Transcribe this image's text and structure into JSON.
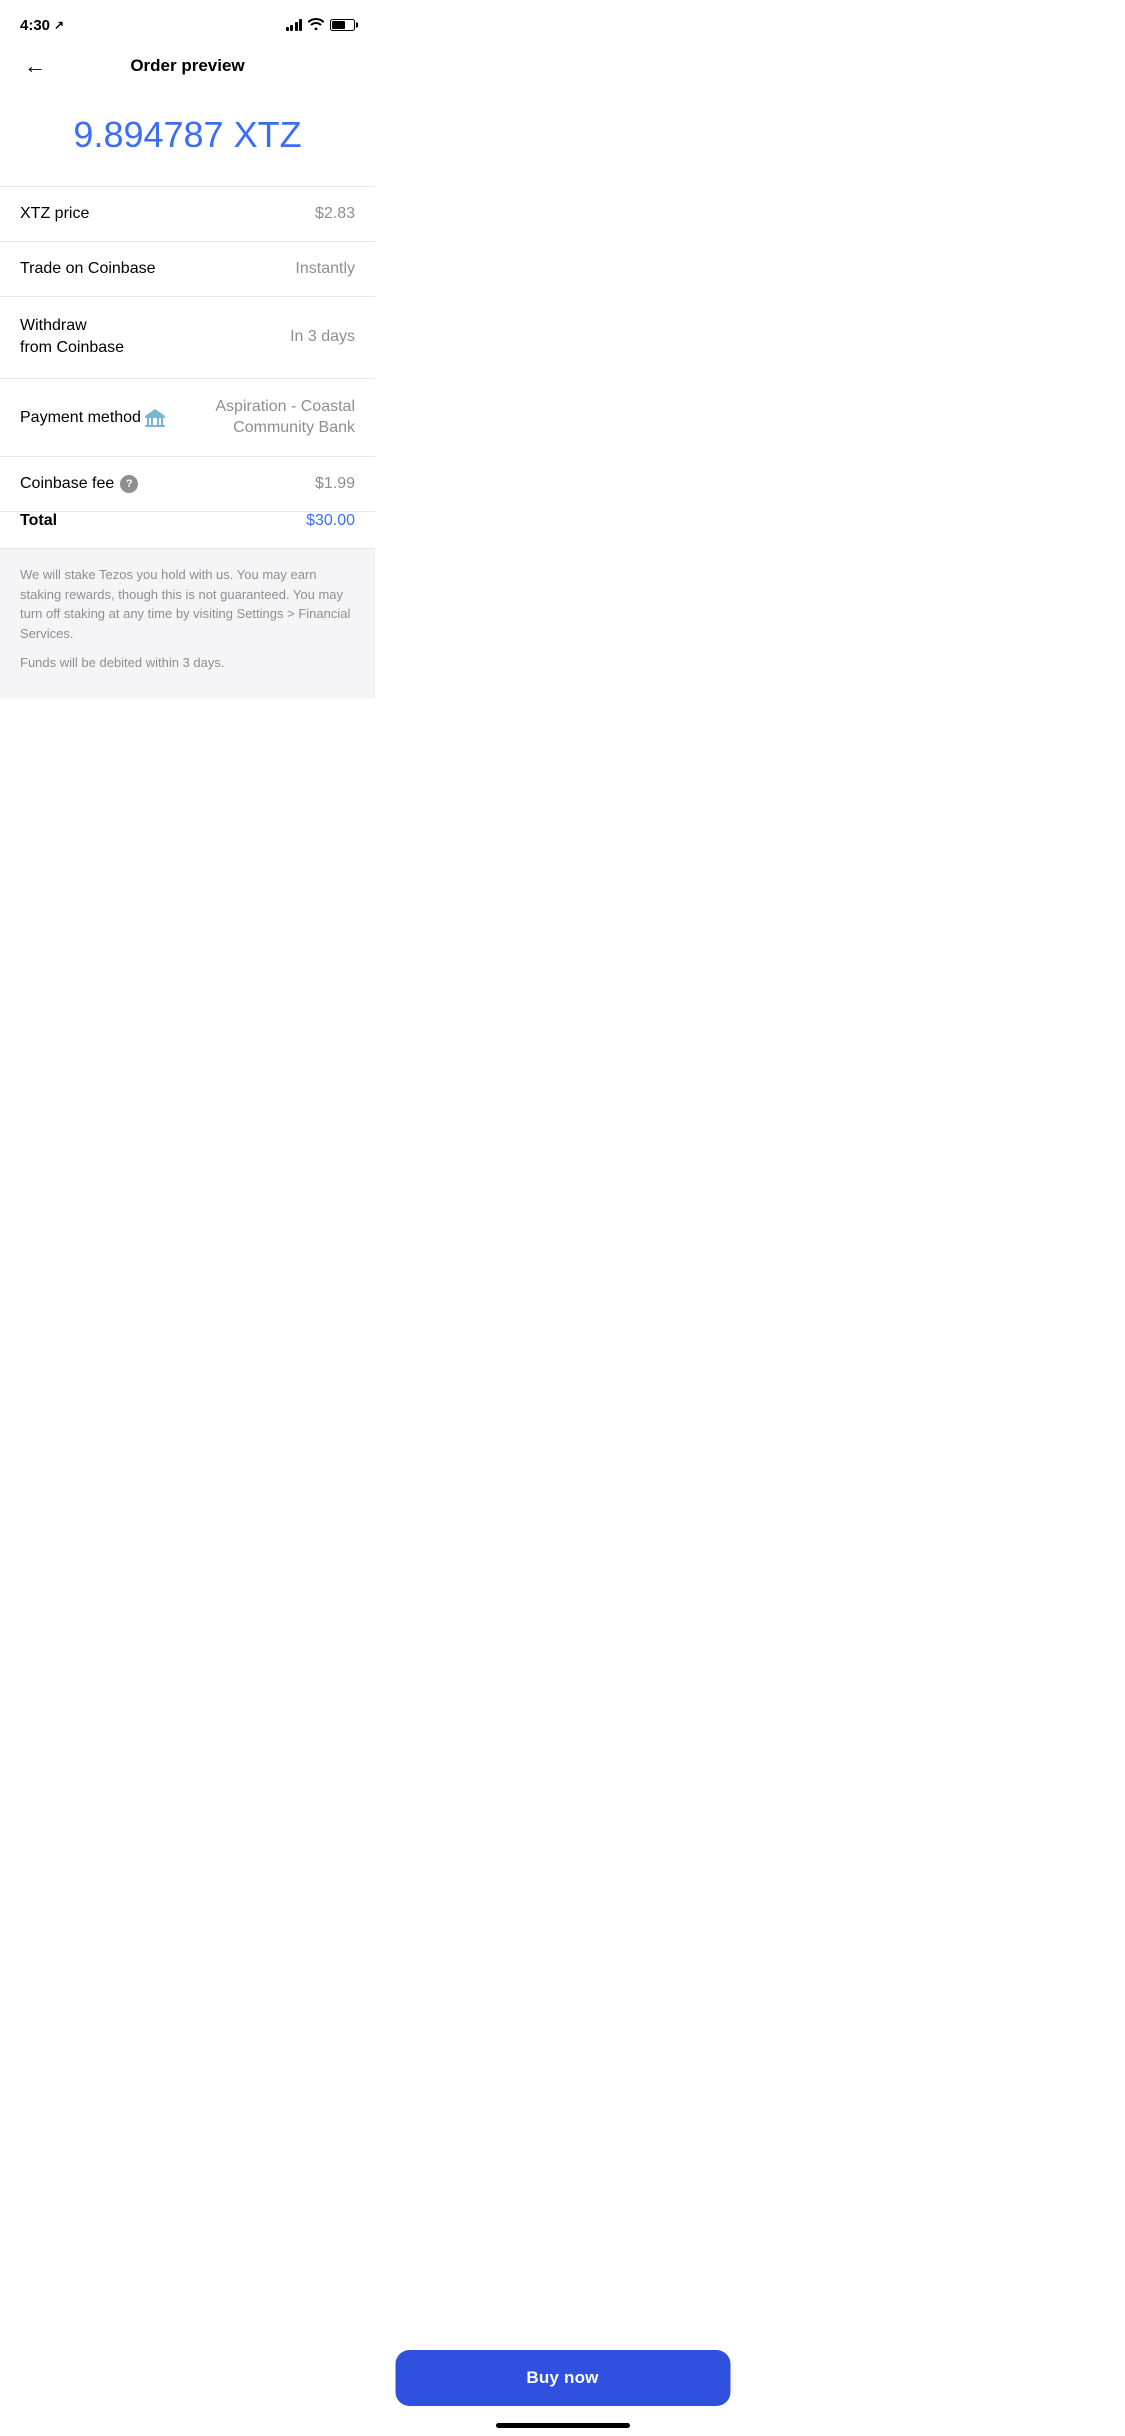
{
  "statusBar": {
    "time": "4:30",
    "locationIcon": "↗"
  },
  "header": {
    "backLabel": "←",
    "title": "Order preview"
  },
  "amount": {
    "value": "9.894787 XTZ"
  },
  "rows": [
    {
      "label": "XTZ price",
      "value": "$2.83"
    },
    {
      "label": "Trade on Coinbase",
      "value": "Instantly"
    }
  ],
  "withdrawRow": {
    "label": "Withdraw\nfrom Coinbase",
    "value": "In 3 days"
  },
  "paymentRow": {
    "label": "Payment method",
    "bankName": "Aspiration - Coastal Community Bank"
  },
  "feeRow": {
    "label": "Coinbase fee",
    "helpIcon": "?",
    "value": "$1.99"
  },
  "totalRow": {
    "label": "Total",
    "value": "$30.00"
  },
  "disclaimers": [
    "We will stake Tezos you hold with us. You may earn staking rewards, though this is not guaranteed. You may turn off staking at any time by visiting Settings > Financial Services.",
    "Funds will be debited within 3 days."
  ],
  "buyButton": {
    "label": "Buy now"
  },
  "colors": {
    "blue": "#3b6ef5",
    "buttonBlue": "#3050e0",
    "gray": "#8e8e93",
    "divider": "#e5e5ea",
    "bgGray": "#f5f5f7"
  }
}
